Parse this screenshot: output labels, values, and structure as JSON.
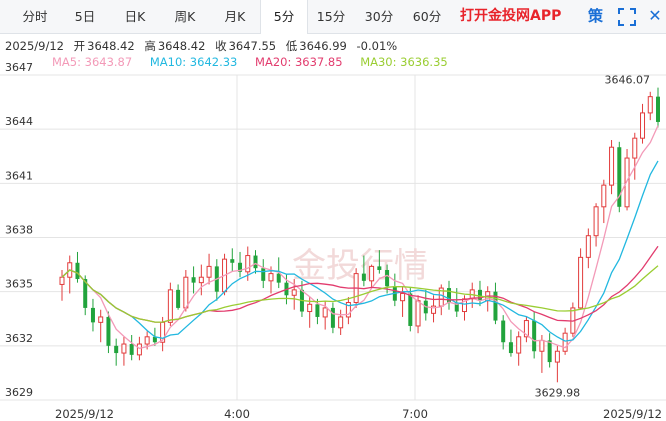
{
  "tabs": [
    {
      "label": "分时",
      "active": false
    },
    {
      "label": "5日",
      "active": false
    },
    {
      "label": "日K",
      "active": false
    },
    {
      "label": "周K",
      "active": false
    },
    {
      "label": "月K",
      "active": false
    },
    {
      "label": "5分",
      "active": true
    },
    {
      "label": "15分",
      "active": false
    },
    {
      "label": "30分",
      "active": false
    },
    {
      "label": "60分",
      "active": false
    }
  ],
  "promo_label": "打开金投网APP",
  "strategy_label": "策",
  "ohlc": {
    "date": "2025/9/12",
    "open_label": "开",
    "open": "3648.42",
    "high_label": "高",
    "high": "3648.42",
    "close_label": "收",
    "close": "3647.55",
    "low_label": "低",
    "low": "3646.99",
    "change": "-0.01%"
  },
  "ma": [
    {
      "label": "MA5: 3643.87",
      "color": "#f39ab8"
    },
    {
      "label": "MA10: 3642.33",
      "color": "#22b8e0"
    },
    {
      "label": "MA20: 3637.85",
      "color": "#e23c6e"
    },
    {
      "label": "MA30: 3636.35",
      "color": "#9acd32"
    }
  ],
  "colors": {
    "up": "#e23c3c",
    "down": "#21a33c",
    "grid": "#e4e4e4",
    "text": "#333333"
  },
  "watermark": "金投行情",
  "chart_data": {
    "type": "candlestick",
    "y_ticks": [
      3629,
      3632,
      3635,
      3638,
      3641,
      3644,
      3647
    ],
    "ylim": [
      3629,
      3647
    ],
    "x_labels": [
      "2025/9/12",
      "4:00",
      "7:00",
      "2025/9/12"
    ],
    "annotations": {
      "max": "3646.07",
      "min": "3629.98"
    },
    "candles": [
      [
        3635.4,
        3636.2,
        3634.5,
        3635.8
      ],
      [
        3635.8,
        3637.0,
        3634.9,
        3636.6
      ],
      [
        3636.6,
        3637.2,
        3635.5,
        3635.7
      ],
      [
        3635.7,
        3635.9,
        3633.7,
        3634.1
      ],
      [
        3634.1,
        3634.6,
        3632.8,
        3633.3
      ],
      [
        3633.3,
        3634.0,
        3632.2,
        3633.6
      ],
      [
        3633.6,
        3633.9,
        3631.6,
        3632.0
      ],
      [
        3632.0,
        3632.4,
        3630.9,
        3631.6
      ],
      [
        3631.6,
        3632.5,
        3630.9,
        3632.1
      ],
      [
        3632.1,
        3632.6,
        3631.2,
        3631.5
      ],
      [
        3631.5,
        3632.5,
        3631.2,
        3632.1
      ],
      [
        3632.1,
        3632.8,
        3631.8,
        3632.5
      ],
      [
        3632.5,
        3633.0,
        3632.0,
        3632.2
      ],
      [
        3632.2,
        3633.6,
        3631.7,
        3633.3
      ],
      [
        3633.3,
        3635.5,
        3633.1,
        3635.1
      ],
      [
        3635.1,
        3635.4,
        3634.0,
        3634.1
      ],
      [
        3634.1,
        3636.2,
        3633.9,
        3635.8
      ],
      [
        3635.8,
        3636.4,
        3634.9,
        3635.5
      ],
      [
        3635.5,
        3636.5,
        3634.8,
        3635.8
      ],
      [
        3635.8,
        3637.1,
        3635.4,
        3636.4
      ],
      [
        3636.4,
        3636.8,
        3634.5,
        3635.0
      ],
      [
        3635.0,
        3637.1,
        3634.8,
        3636.8
      ],
      [
        3636.8,
        3637.4,
        3636.1,
        3636.6
      ],
      [
        3636.6,
        3637.2,
        3635.8,
        3636.1
      ],
      [
        3636.1,
        3637.5,
        3635.6,
        3637.0
      ],
      [
        3637.0,
        3637.3,
        3636.0,
        3636.3
      ],
      [
        3636.3,
        3636.8,
        3635.2,
        3635.6
      ],
      [
        3635.6,
        3636.4,
        3634.9,
        3636.0
      ],
      [
        3636.0,
        3636.9,
        3635.2,
        3635.5
      ],
      [
        3635.5,
        3636.0,
        3634.3,
        3634.8
      ],
      [
        3634.8,
        3635.7,
        3634.0,
        3635.1
      ],
      [
        3635.1,
        3635.6,
        3633.6,
        3633.9
      ],
      [
        3633.9,
        3634.7,
        3633.0,
        3634.3
      ],
      [
        3634.3,
        3634.6,
        3633.2,
        3633.6
      ],
      [
        3633.6,
        3634.5,
        3632.9,
        3634.1
      ],
      [
        3634.1,
        3634.4,
        3632.7,
        3633.0
      ],
      [
        3633.0,
        3634.0,
        3632.6,
        3633.6
      ],
      [
        3633.6,
        3634.7,
        3633.2,
        3634.4
      ],
      [
        3634.4,
        3636.3,
        3634.1,
        3636.0
      ],
      [
        3636.0,
        3637.0,
        3635.3,
        3635.6
      ],
      [
        3635.6,
        3636.5,
        3635.2,
        3636.4
      ],
      [
        3636.4,
        3637.3,
        3636.0,
        3636.2
      ],
      [
        3636.2,
        3636.5,
        3634.9,
        3635.3
      ],
      [
        3635.3,
        3636.0,
        3634.2,
        3634.5
      ],
      [
        3634.5,
        3635.3,
        3633.6,
        3634.9
      ],
      [
        3634.9,
        3635.2,
        3632.8,
        3633.1
      ],
      [
        3633.1,
        3634.8,
        3632.7,
        3634.5
      ],
      [
        3634.5,
        3635.1,
        3633.4,
        3633.8
      ],
      [
        3633.8,
        3634.8,
        3633.3,
        3634.2
      ],
      [
        3634.2,
        3635.4,
        3633.7,
        3635.2
      ],
      [
        3635.2,
        3635.6,
        3634.0,
        3634.4
      ],
      [
        3634.4,
        3635.2,
        3633.6,
        3633.9
      ],
      [
        3633.9,
        3634.8,
        3633.4,
        3634.6
      ],
      [
        3634.6,
        3635.5,
        3634.1,
        3635.1
      ],
      [
        3635.1,
        3635.6,
        3634.2,
        3634.5
      ],
      [
        3634.5,
        3635.3,
        3633.9,
        3635.0
      ],
      [
        3635.0,
        3635.5,
        3633.2,
        3633.4
      ],
      [
        3633.4,
        3633.7,
        3631.8,
        3632.2
      ],
      [
        3632.2,
        3632.9,
        3631.4,
        3631.6
      ],
      [
        3631.6,
        3632.8,
        3630.9,
        3632.5
      ],
      [
        3632.5,
        3633.6,
        3632.2,
        3633.4
      ],
      [
        3633.4,
        3633.9,
        3631.3,
        3631.7
      ],
      [
        3631.7,
        3632.6,
        3630.5,
        3632.3
      ],
      [
        3632.3,
        3632.7,
        3630.8,
        3631.1
      ],
      [
        3631.1,
        3632.0,
        3629.98,
        3631.7
      ],
      [
        3631.7,
        3633.0,
        3631.5,
        3632.7
      ],
      [
        3632.7,
        3634.4,
        3632.5,
        3634.1
      ],
      [
        3634.1,
        3637.4,
        3634.0,
        3636.9
      ],
      [
        3636.9,
        3638.5,
        3636.3,
        3638.1
      ],
      [
        3638.1,
        3639.9,
        3637.5,
        3639.7
      ],
      [
        3639.7,
        3641.2,
        3638.8,
        3640.9
      ],
      [
        3640.9,
        3643.4,
        3640.4,
        3643.0
      ],
      [
        3643.0,
        3643.3,
        3639.4,
        3639.7
      ],
      [
        3639.7,
        3642.9,
        3639.5,
        3642.4
      ],
      [
        3642.4,
        3643.8,
        3641.2,
        3643.5
      ],
      [
        3643.5,
        3645.4,
        3643.2,
        3644.9
      ],
      [
        3644.9,
        3646.07,
        3644.5,
        3645.8
      ],
      [
        3645.8,
        3646.3,
        3644.1,
        3644.4
      ]
    ]
  }
}
